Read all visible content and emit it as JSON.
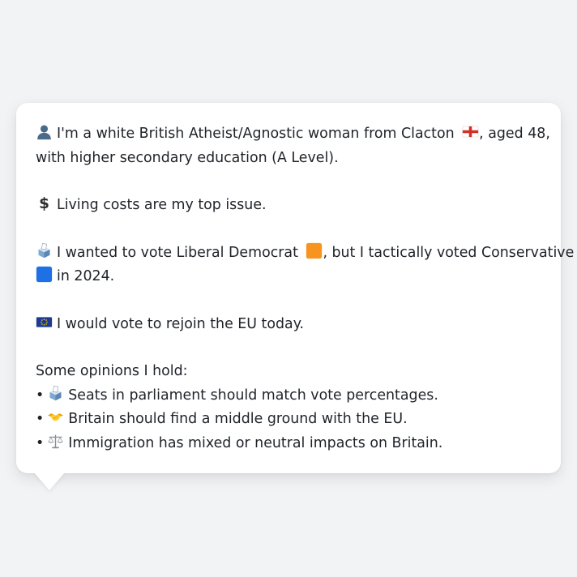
{
  "profile": {
    "identity_pre": "I'm a white British Atheist/Agnostic woman from Clacton",
    "identity_post": ", aged 48,",
    "education": "with higher secondary education (A Level).",
    "issue": "Living costs are my top issue.",
    "vote_pre": "I wanted to vote Liberal Democrat",
    "vote_mid": ", but I tactically voted Conservative",
    "vote_post": "in 2024.",
    "eu": "I would vote to rejoin the EU today.",
    "opinions_heading": "Some opinions I hold:",
    "bullet_char": "•",
    "opinions": [
      "Seats in parliament should match vote percentages.",
      "Britain should find a middle ground with the EU.",
      "Immigration has mixed or neutral impacts on Britain."
    ]
  },
  "icons": {
    "person": "person-silhouette-icon",
    "england_flag": "england-flag-icon",
    "dollar": "heavy-dollar-sign-icon",
    "ballot": "ballot-box-icon",
    "lib_dem_square": "orange-square-icon",
    "conservative_square": "blue-square-icon",
    "eu_flag": "eu-flag-icon",
    "handshake": "handshake-icon",
    "scales": "balance-scale-icon"
  },
  "colors": {
    "page_background": "#f2f3f5",
    "card_background": "#ffffff",
    "text": "#1f2328",
    "lib_dem_orange": "#f7931e",
    "conservative_blue": "#1f6fe5",
    "eu_blue": "#1f3a93",
    "england_red": "#d22f27"
  }
}
